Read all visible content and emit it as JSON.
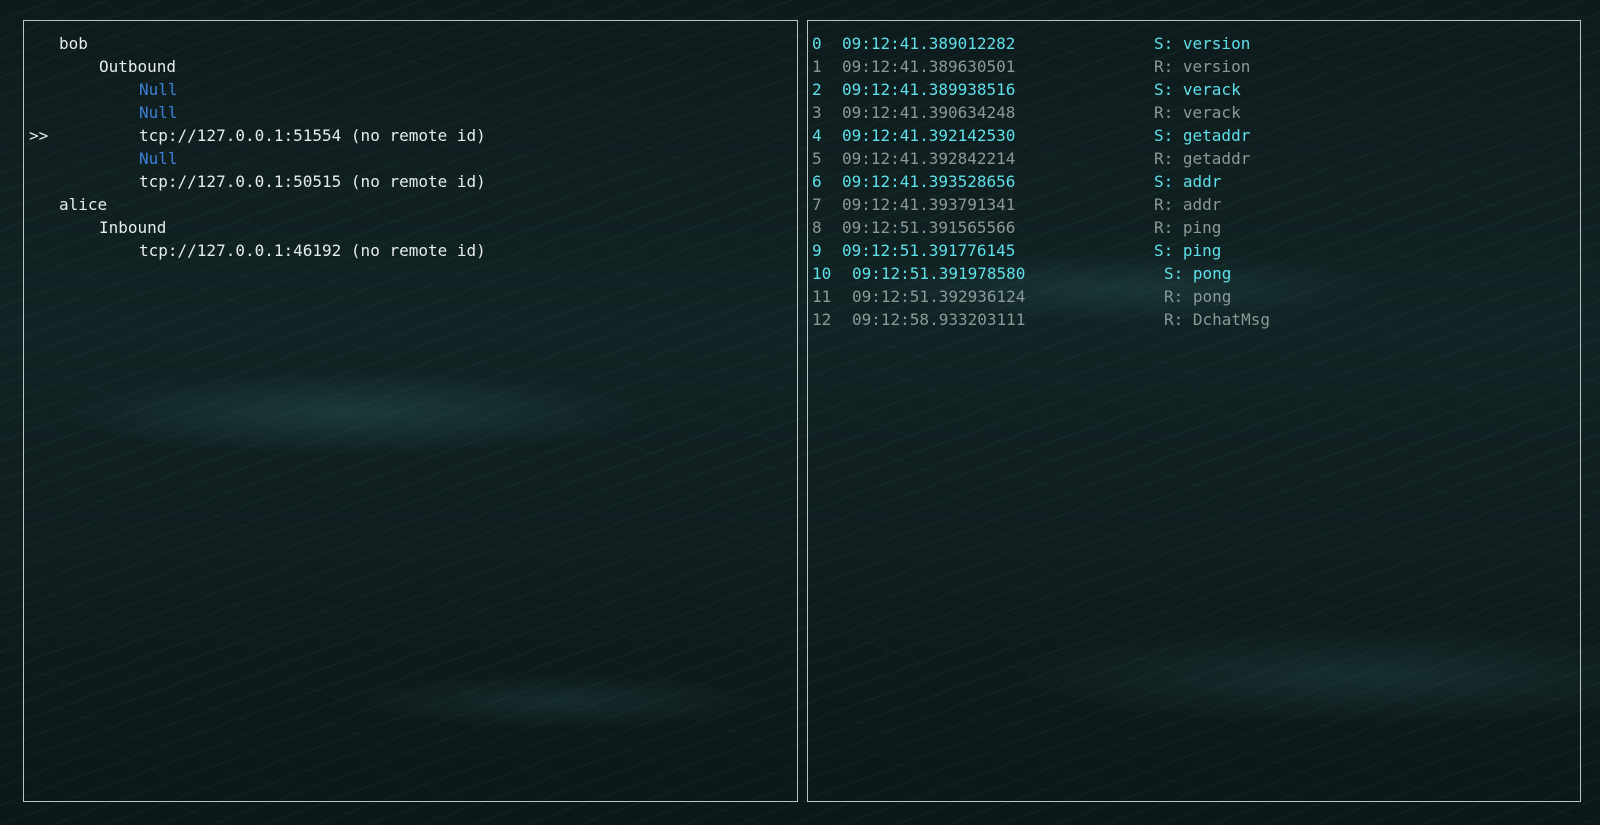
{
  "left_panel": {
    "selected_marker": ">>",
    "tree": [
      {
        "text": "bob",
        "level": 0,
        "kind": "node",
        "selected": false
      },
      {
        "text": "Outbound",
        "level": 1,
        "kind": "node",
        "selected": false
      },
      {
        "text": "Null",
        "level": 2,
        "kind": "null",
        "selected": false
      },
      {
        "text": "Null",
        "level": 2,
        "kind": "null",
        "selected": false
      },
      {
        "text": "tcp://127.0.0.1:51554 (no remote id)",
        "level": 2,
        "kind": "conn",
        "selected": true
      },
      {
        "text": "Null",
        "level": 2,
        "kind": "null",
        "selected": false
      },
      {
        "text": "tcp://127.0.0.1:50515 (no remote id)",
        "level": 2,
        "kind": "conn",
        "selected": false
      },
      {
        "text": "alice",
        "level": 0,
        "kind": "node",
        "selected": false
      },
      {
        "text": "Inbound",
        "level": 1,
        "kind": "node",
        "selected": false
      },
      {
        "text": "tcp://127.0.0.1:46192 (no remote id)",
        "level": 2,
        "kind": "conn",
        "selected": false
      }
    ]
  },
  "right_panel": {
    "messages": [
      {
        "index": "0",
        "time": "09:12:41.389012282",
        "cmd": "S: version",
        "dir": "sent"
      },
      {
        "index": "1",
        "time": "09:12:41.389630501",
        "cmd": "R: version",
        "dir": "recv"
      },
      {
        "index": "2",
        "time": "09:12:41.389938516",
        "cmd": "S: verack",
        "dir": "sent"
      },
      {
        "index": "3",
        "time": "09:12:41.390634248",
        "cmd": "R: verack",
        "dir": "recv"
      },
      {
        "index": "4",
        "time": "09:12:41.392142530",
        "cmd": "S: getaddr",
        "dir": "sent"
      },
      {
        "index": "5",
        "time": "09:12:41.392842214",
        "cmd": "R: getaddr",
        "dir": "recv"
      },
      {
        "index": "6",
        "time": "09:12:41.393528656",
        "cmd": "S: addr",
        "dir": "sent"
      },
      {
        "index": "7",
        "time": "09:12:41.393791341",
        "cmd": "R: addr",
        "dir": "recv"
      },
      {
        "index": "8",
        "time": "09:12:51.391565566",
        "cmd": "R: ping",
        "dir": "recv"
      },
      {
        "index": "9",
        "time": "09:12:51.391776145",
        "cmd": "S: ping",
        "dir": "sent"
      },
      {
        "index": "10",
        "time": "09:12:51.391978580",
        "cmd": "S: pong",
        "dir": "sent"
      },
      {
        "index": "11",
        "time": "09:12:51.392936124",
        "cmd": "R: pong",
        "dir": "recv"
      },
      {
        "index": "12",
        "time": "09:12:58.933203111",
        "cmd": "R: DchatMsg",
        "dir": "recv"
      }
    ]
  },
  "colors": {
    "sent": "#5ee0ea",
    "recv": "#8b9999",
    "null_entry": "#3d7fd6",
    "text": "#e6ecec",
    "border": "#b9c4c4"
  }
}
